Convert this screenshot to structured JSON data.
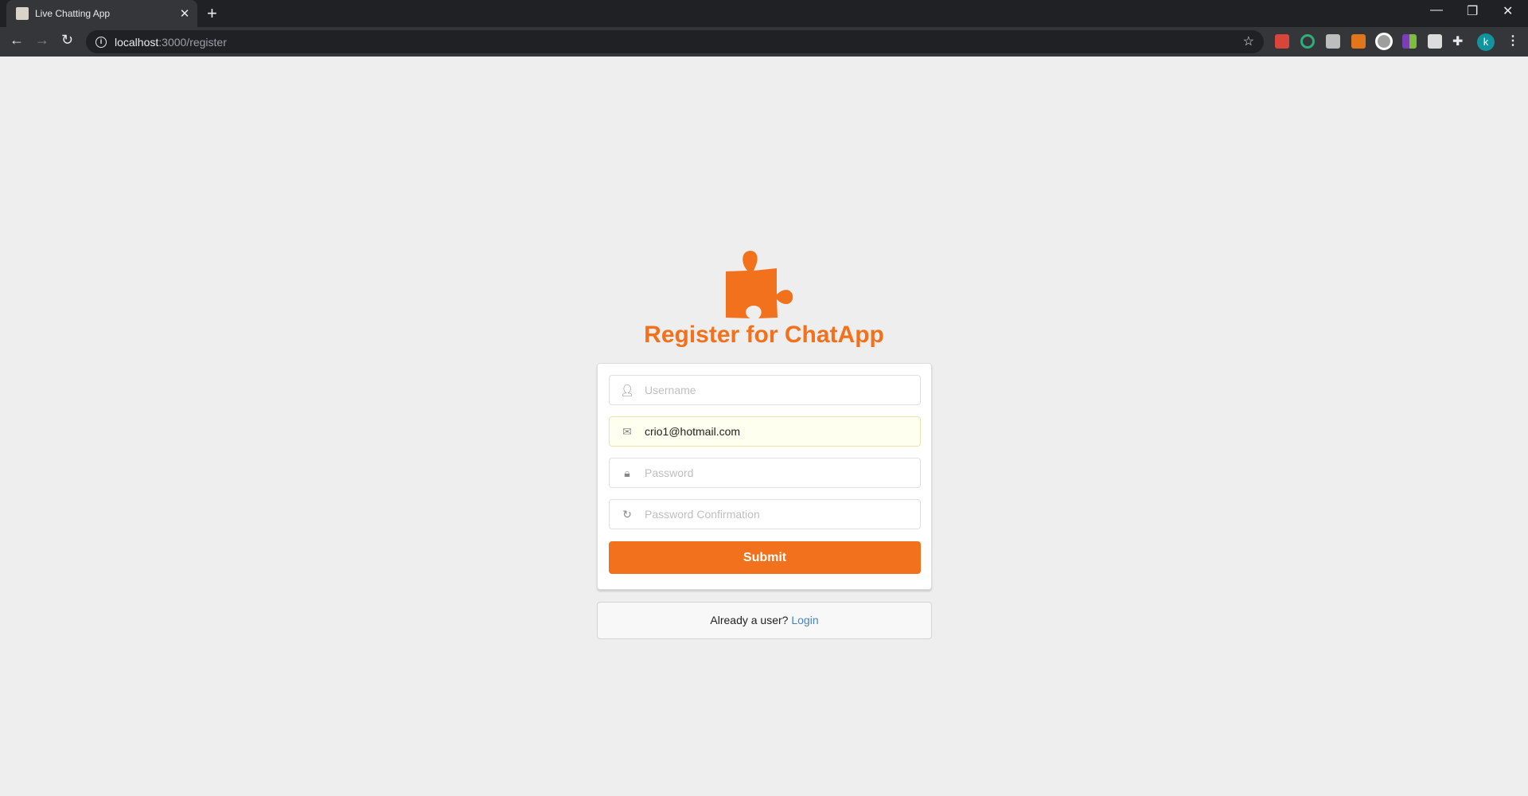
{
  "browser": {
    "tab_title": "Live Chatting App",
    "url_host": "localhost",
    "url_path": ":3000/register",
    "profile_initial": "k",
    "extensions": [
      {
        "name": "ext-red",
        "color": "#d9453b"
      },
      {
        "name": "ext-green-ring",
        "color": "#2fae7a"
      },
      {
        "name": "ext-h",
        "color": "#bdbdbd"
      },
      {
        "name": "metamask-fox",
        "color": "#e2761b"
      },
      {
        "name": "ext-sync",
        "color": "#cfcfcf"
      },
      {
        "name": "ext-colorful",
        "color": "#7b3fb5"
      },
      {
        "name": "ext-blank",
        "color": "#dcdcdc"
      }
    ]
  },
  "page": {
    "title": "Register for ChatApp",
    "brand_color": "#f2711c",
    "fields": {
      "username": {
        "placeholder": "Username",
        "value": ""
      },
      "email": {
        "placeholder": "Email",
        "value": "crio1@hotmail.com"
      },
      "password": {
        "placeholder": "Password",
        "value": ""
      },
      "confirm": {
        "placeholder": "Password Confirmation",
        "value": ""
      }
    },
    "submit_label": "Submit",
    "footer_text": "Already a user? ",
    "login_link": "Login"
  }
}
